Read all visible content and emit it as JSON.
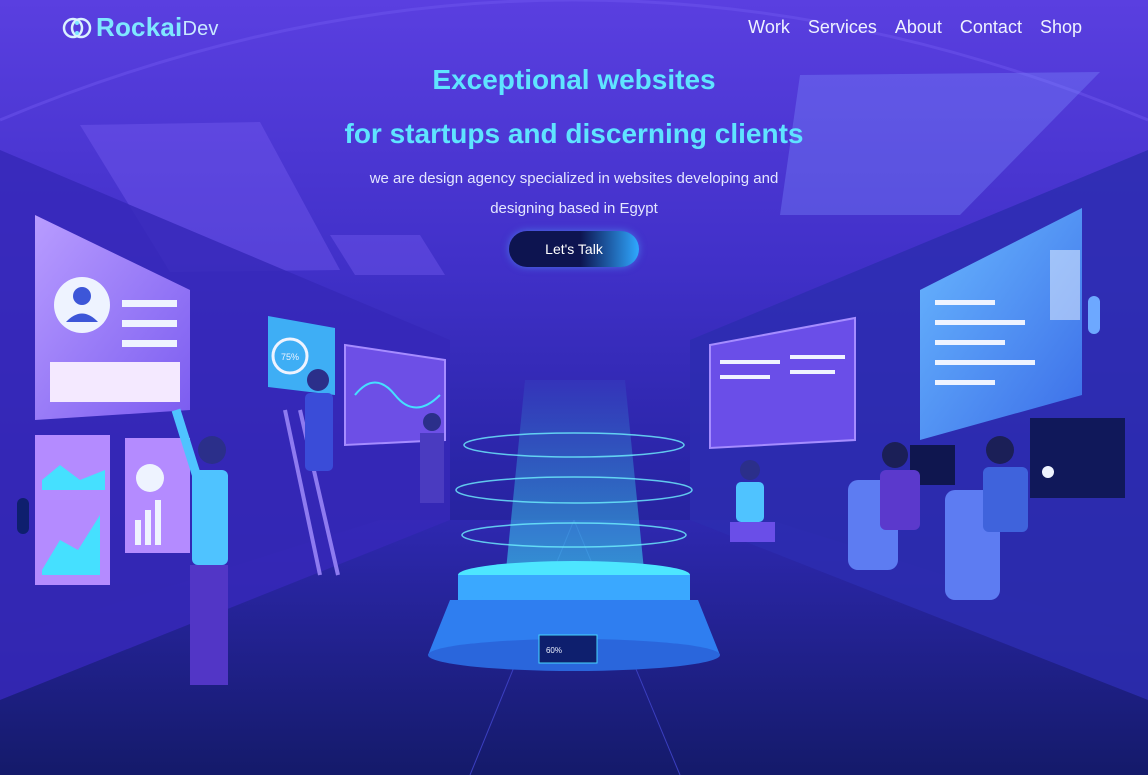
{
  "brand": {
    "name_bold": "Rockai",
    "name_light": "Dev"
  },
  "nav": {
    "items": [
      {
        "label": "Work"
      },
      {
        "label": "Services"
      },
      {
        "label": "About"
      },
      {
        "label": "Contact"
      },
      {
        "label": "Shop"
      }
    ]
  },
  "hero": {
    "headline_line1": "Exceptional websites",
    "headline_line2": "for startups and discerning clients",
    "subtitle_line1": "we are design agency specialized in websites developing and",
    "subtitle_line2": "designing based in Egypt",
    "cta_label": "Let's Talk"
  },
  "illustration": {
    "panel_progress_label": "75%",
    "pedestal_progress_label": "60%"
  },
  "colors": {
    "accent": "#5fe4ff",
    "background_top": "#5a3fe0",
    "background_bottom": "#1a1f7a"
  }
}
